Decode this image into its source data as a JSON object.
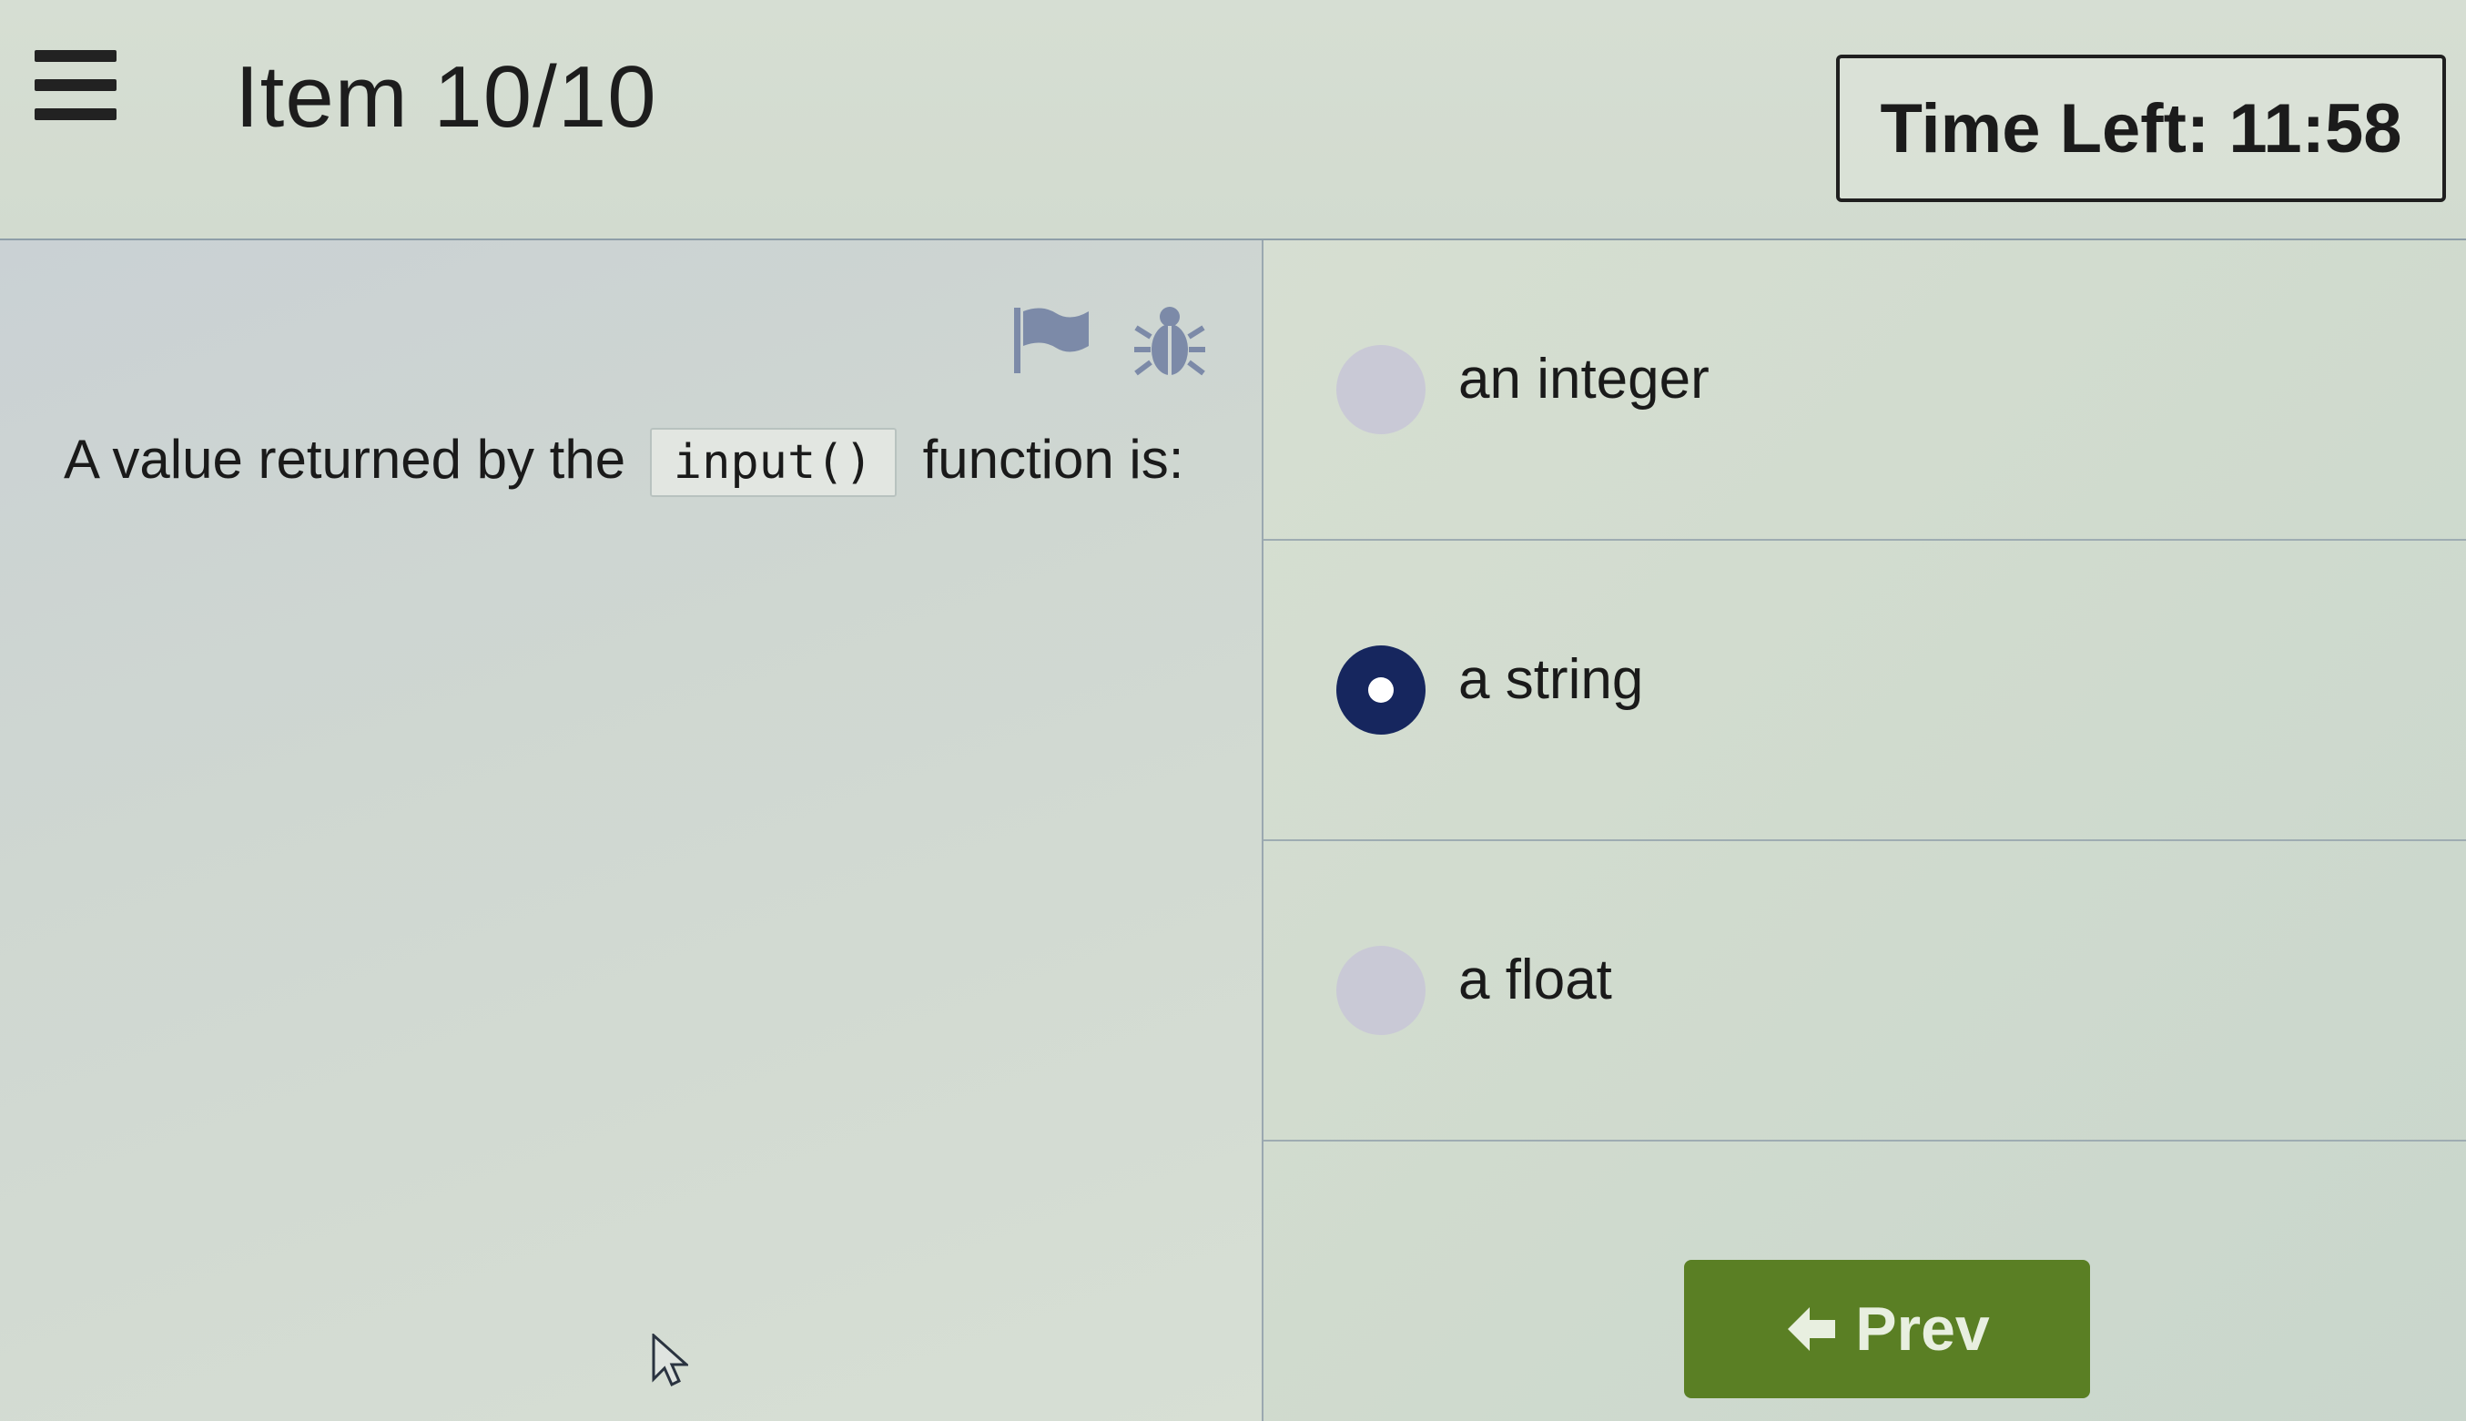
{
  "header": {
    "item_label": "Item 10/10",
    "timer_text": "Time Left: 11:58"
  },
  "toolbar": {
    "flag_icon": "flag-icon",
    "bug_icon": "bug-icon"
  },
  "question": {
    "text_before": "A value returned by the",
    "code": "input()",
    "text_after": "function is:"
  },
  "options": [
    {
      "label": "an integer",
      "selected": false
    },
    {
      "label": "a string",
      "selected": true
    },
    {
      "label": "a float",
      "selected": false
    }
  ],
  "nav": {
    "prev_label": "Prev",
    "prev_icon": "arrow-left-icon"
  },
  "colors": {
    "selected_radio": "#16265e",
    "prev_button": "#5a7f24"
  }
}
